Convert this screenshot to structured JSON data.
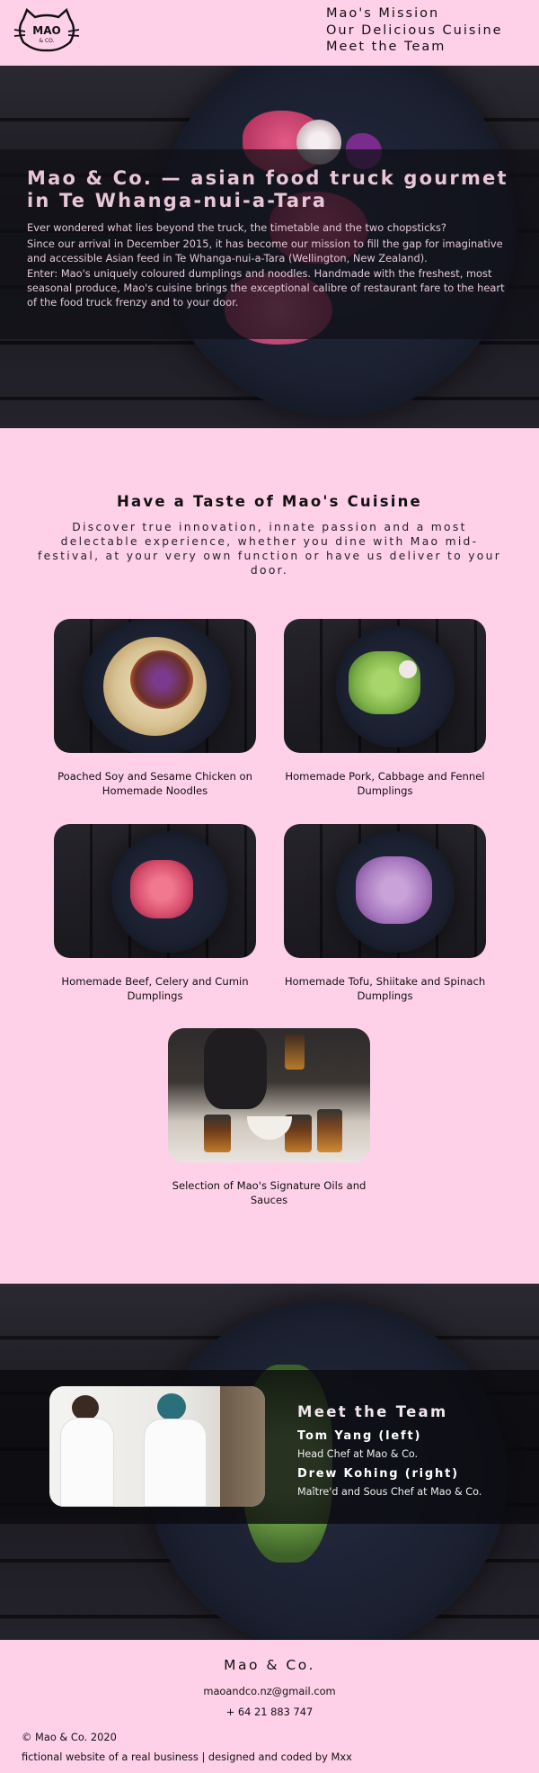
{
  "logo": {
    "text_top": "MAO",
    "text_bottom": "& CO."
  },
  "nav": {
    "items": [
      "Mao's Mission",
      "Our Delicious Cuisine",
      "Meet the Team"
    ]
  },
  "hero": {
    "title": "Mao & Co. — asian food truck gourmet in Te Whanga-nui-a-Tara",
    "paragraphs": [
      "Ever wondered what lies beyond the truck, the timetable and the two chopsticks?",
      "Since our arrival in December 2015, it has become our mission to fill the gap for imaginative and accessible Asian feed in Te Whanga-nui-a-Tara (Wellington, New Zealand).",
      "Enter: Mao's uniquely coloured dumplings and noodles. Handmade with the freshest, most seasonal produce, Mao's cuisine brings the exceptional calibre of restaurant fare to the heart of the food truck frenzy and to your door."
    ]
  },
  "cuisine": {
    "heading": "Have a Taste of Mao's Cuisine",
    "intro": "Discover true innovation, innate passion and a most delectable experience, whether you dine with Mao mid-festival, at your very own function or have us deliver to your door.",
    "dishes": [
      "Poached Soy and Sesame Chicken on Homemade Noodles",
      "Homemade Pork, Cabbage and Fennel Dumplings",
      "Homemade Beef, Celery and Cumin Dumplings",
      "Homemade Tofu, Shiitake and Spinach Dumplings",
      "Selection of Mao's Signature Oils and Sauces"
    ]
  },
  "team": {
    "heading": "Meet the Team",
    "members": [
      {
        "name": "Tom Yang (left)",
        "role": "Head Chef at Mao & Co."
      },
      {
        "name": "Drew Kohing (right)",
        "role": "Maître'd and Sous Chef at Mao & Co."
      }
    ]
  },
  "footer": {
    "brand": "Mao & Co.",
    "email": "maoandco.nz@gmail.com",
    "phone": "+ 64 21 883 747",
    "copyright": "© Mao & Co. 2020",
    "credit": "fictional website of a real business | designed and coded by Mxx"
  },
  "colors": {
    "background_pink": "#ffd1e8",
    "dark_wood": "#1c1a20",
    "hero_text": "#e8c6d6"
  }
}
